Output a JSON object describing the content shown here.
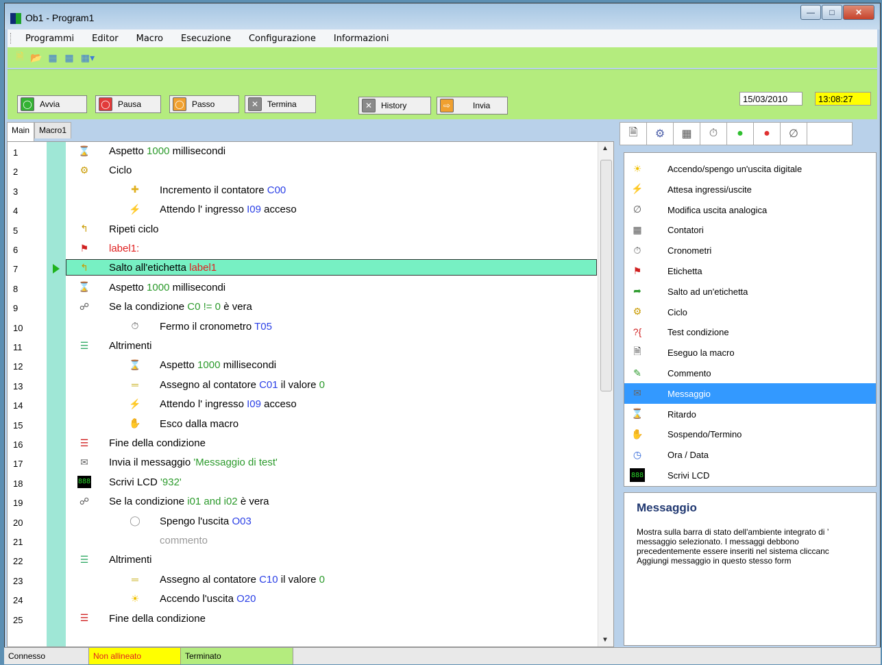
{
  "window": {
    "title": "Ob1 - Program1"
  },
  "window_controls": [
    "minimize",
    "maximize",
    "close"
  ],
  "menu": [
    "Programmi",
    "Editor",
    "Macro",
    "Esecuzione",
    "Configurazione",
    "Informazioni"
  ],
  "toolbar_icons": [
    "new-file-icon",
    "open-folder-icon",
    "image-icon",
    "image-icon-2",
    "image-dropdown-icon"
  ],
  "actions": [
    {
      "label": "Avvia",
      "color": "#33b233"
    },
    {
      "label": "Pausa",
      "color": "#e23a3a"
    },
    {
      "label": "Passo",
      "color": "#f0a030"
    },
    {
      "label": "Termina",
      "color": "#8a8a8a"
    },
    {
      "label": "History",
      "color": "#8a8a8a"
    },
    {
      "label": "Invia",
      "color": "#f0a030"
    }
  ],
  "date": "15/03/2010",
  "time": "13:08:27",
  "tabs": [
    "Main",
    "Macro1"
  ],
  "lines": [
    {
      "n": "1",
      "icon": "hourglass-icon",
      "indent": 0,
      "parts": [
        {
          "t": "Aspetto "
        },
        {
          "t": "1000",
          "c": "g"
        },
        {
          "t": " millisecondi"
        }
      ]
    },
    {
      "n": "2",
      "icon": "cycle-icon",
      "indent": 0,
      "parts": [
        {
          "t": "Ciclo"
        }
      ]
    },
    {
      "n": "3",
      "icon": "plus-icon",
      "indent": 1,
      "parts": [
        {
          "t": "Incremento il contatore "
        },
        {
          "t": "C00",
          "c": "b"
        }
      ]
    },
    {
      "n": "4",
      "icon": "lightning-icon",
      "indent": 1,
      "parts": [
        {
          "t": "Attendo l' ingresso "
        },
        {
          "t": "I09",
          "c": "b"
        },
        {
          "t": " acceso"
        }
      ]
    },
    {
      "n": "5",
      "icon": "return-arrow-icon",
      "indent": 0,
      "parts": [
        {
          "t": "Ripeti ciclo"
        }
      ]
    },
    {
      "n": "6",
      "icon": "flag-icon",
      "indent": 0,
      "parts": [
        {
          "t": "label1:",
          "c": "r"
        }
      ]
    },
    {
      "n": "7",
      "icon": "return-arrow-icon",
      "indent": 0,
      "selected": true,
      "parts": [
        {
          "t": "Salto all'etichetta "
        },
        {
          "t": "label1",
          "c": "r"
        }
      ]
    },
    {
      "n": "8",
      "icon": "hourglass-icon",
      "indent": 0,
      "parts": [
        {
          "t": "Aspetto "
        },
        {
          "t": "1000",
          "c": "g"
        },
        {
          "t": " millisecondi"
        }
      ]
    },
    {
      "n": "9",
      "icon": "tree-icon",
      "indent": 0,
      "parts": [
        {
          "t": "Se la condizione  "
        },
        {
          "t": "C0 != 0",
          "c": "g"
        },
        {
          "t": " è vera"
        }
      ]
    },
    {
      "n": "10",
      "icon": "stopwatch-icon",
      "indent": 1,
      "parts": [
        {
          "t": "Fermo il cronometro  "
        },
        {
          "t": "T05",
          "c": "b"
        }
      ]
    },
    {
      "n": "11",
      "icon": "else-icon",
      "indent": 0,
      "parts": [
        {
          "t": "Altrimenti"
        }
      ]
    },
    {
      "n": "12",
      "icon": "hourglass-icon",
      "indent": 1,
      "parts": [
        {
          "t": "Aspetto "
        },
        {
          "t": "1000",
          "c": "g"
        },
        {
          "t": " millisecondi"
        }
      ]
    },
    {
      "n": "13",
      "icon": "equals-icon",
      "indent": 1,
      "parts": [
        {
          "t": "Assegno al contatore  "
        },
        {
          "t": "C01",
          "c": "b"
        },
        {
          "t": " il valore "
        },
        {
          "t": "0",
          "c": "g"
        }
      ]
    },
    {
      "n": "14",
      "icon": "lightning-icon",
      "indent": 1,
      "parts": [
        {
          "t": "Attendo l' ingresso  "
        },
        {
          "t": "I09",
          "c": "b"
        },
        {
          "t": " acceso"
        }
      ]
    },
    {
      "n": "15",
      "icon": "hand-icon",
      "indent": 1,
      "parts": [
        {
          "t": "Esco dalla macro"
        }
      ]
    },
    {
      "n": "16",
      "icon": "end-condition-icon",
      "indent": 0,
      "parts": [
        {
          "t": "Fine della condizione"
        }
      ]
    },
    {
      "n": "17",
      "icon": "envelope-icon",
      "indent": 0,
      "parts": [
        {
          "t": "Invia il messaggio  "
        },
        {
          "t": "'Messaggio di test'",
          "c": "g"
        }
      ]
    },
    {
      "n": "18",
      "icon": "lcd-icon",
      "indent": 0,
      "parts": [
        {
          "t": "Scrivi LCD "
        },
        {
          "t": "'932'",
          "c": "g"
        }
      ]
    },
    {
      "n": "19",
      "icon": "tree-icon",
      "indent": 0,
      "parts": [
        {
          "t": "Se la condizione  "
        },
        {
          "t": "i01 and i02",
          "c": "g"
        },
        {
          "t": "  è vera"
        }
      ]
    },
    {
      "n": "20",
      "icon": "bulb-off-icon",
      "indent": 1,
      "parts": [
        {
          "t": "Spengo l'uscita  "
        },
        {
          "t": "O03",
          "c": "b"
        }
      ]
    },
    {
      "n": "21",
      "icon": "",
      "indent": 1,
      "parts": [
        {
          "t": "commento",
          "c": "gr"
        }
      ]
    },
    {
      "n": "22",
      "icon": "else-icon",
      "indent": 0,
      "parts": [
        {
          "t": "Altrimenti"
        }
      ]
    },
    {
      "n": "23",
      "icon": "equals-icon",
      "indent": 1,
      "parts": [
        {
          "t": "Assegno al contatore  "
        },
        {
          "t": "C10",
          "c": "b"
        },
        {
          "t": " il valore "
        },
        {
          "t": "0",
          "c": "g"
        }
      ]
    },
    {
      "n": "24",
      "icon": "bulb-on-icon",
      "indent": 1,
      "parts": [
        {
          "t": "Accendo l'uscita  "
        },
        {
          "t": "O20",
          "c": "b"
        }
      ]
    },
    {
      "n": "25",
      "icon": "end-condition-icon",
      "indent": 0,
      "parts": [
        {
          "t": "Fine della condizione"
        }
      ]
    }
  ],
  "right_tabs": [
    "document-icon",
    "gear-icon",
    "calculator-icon",
    "stopwatch-icon",
    "green-led-icon",
    "red-led-icon",
    "analog-icon"
  ],
  "commands": [
    {
      "label": "Accendo/spengo un'uscita digitale",
      "icon": "bulb-icon"
    },
    {
      "label": "Attesa ingressi/uscite",
      "icon": "lightning-icon"
    },
    {
      "label": "Modifica uscita analogica",
      "icon": "analog-icon"
    },
    {
      "label": "Contatori",
      "icon": "calculator-icon"
    },
    {
      "label": "Cronometri",
      "icon": "stopwatch-icon"
    },
    {
      "label": "Etichetta",
      "icon": "flag-icon"
    },
    {
      "label": "Salto ad un'etichetta",
      "icon": "jump-arrow-icon"
    },
    {
      "label": "Ciclo",
      "icon": "cycle-icon"
    },
    {
      "label": "Test condizione",
      "icon": "test-condition-icon"
    },
    {
      "label": "Eseguo la macro",
      "icon": "document-icon"
    },
    {
      "label": "Commento",
      "icon": "comment-icon"
    },
    {
      "label": "Messaggio",
      "icon": "envelope-icon",
      "selected": true
    },
    {
      "label": "Ritardo",
      "icon": "hourglass-icon"
    },
    {
      "label": "Sospendo/Termino",
      "icon": "hand-icon"
    },
    {
      "label": "Ora / Data",
      "icon": "clock-icon"
    },
    {
      "label": "Scrivi LCD",
      "icon": "lcd-icon"
    }
  ],
  "description": {
    "title": "Messaggio",
    "text": "Mostra sulla barra di stato dell'ambiente integrato di ’\nmessaggio selezionato. I messaggi debbono\nprecedentemente essere inseriti nel sistema cliccanc\nAggiungi messaggio in questo stesso form"
  },
  "status": [
    {
      "label": "Connesso",
      "bg": "#e9e9e9",
      "color": "#000"
    },
    {
      "label": "Non allineato",
      "bg": "#ffff00",
      "color": "#e02020"
    },
    {
      "label": "Terminato",
      "bg": "#b4ec7e",
      "color": "#000"
    }
  ]
}
